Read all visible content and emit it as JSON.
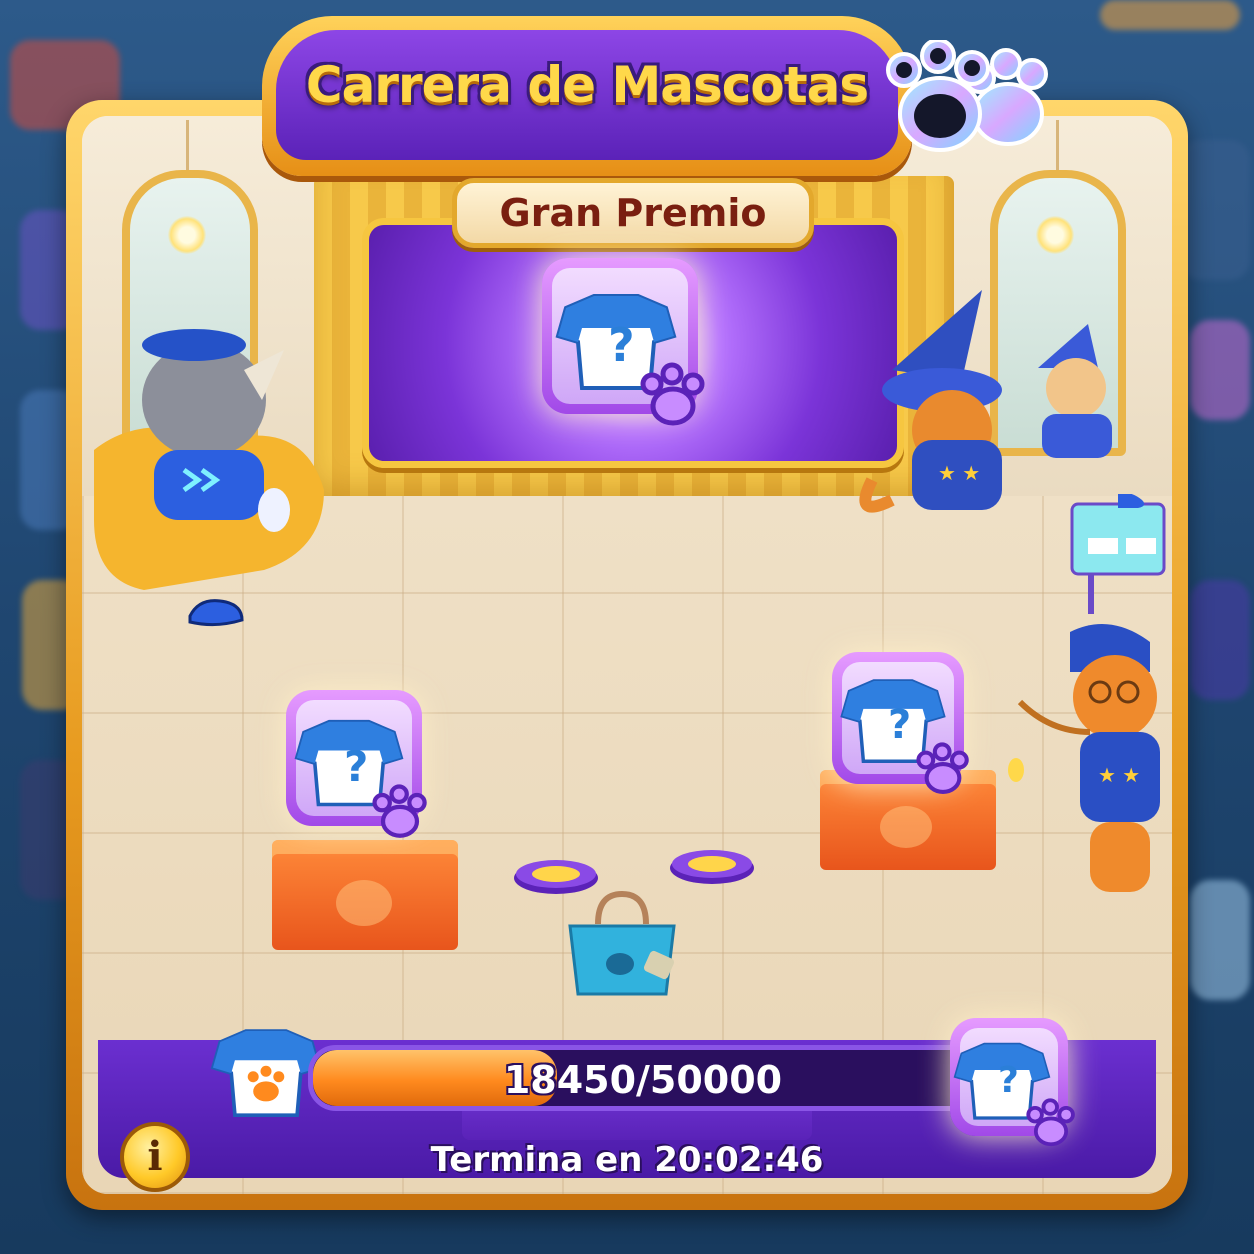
{
  "event": {
    "title": "Carrera de Mascotas",
    "grand_prize_label": "Gran Premio"
  },
  "progress": {
    "current": 18450,
    "goal": 50000,
    "text": "18450/50000",
    "fraction": 0.369
  },
  "timer": {
    "text": "Termina en 20:02:46"
  },
  "info_button": {
    "label": "i"
  },
  "rewards": [
    {
      "name": "grand-prize",
      "symbol": "?"
    },
    {
      "name": "left-reward",
      "symbol": "?"
    },
    {
      "name": "right-reward",
      "symbol": "?"
    },
    {
      "name": "progress-goal-reward",
      "symbol": "?"
    }
  ],
  "colors": {
    "frame_gold": "#e79a1f",
    "panel_purple": "#5b22b8",
    "progress_orange": "#ff8a1e",
    "title_yellow": "#ffd84a"
  },
  "icons": [
    "paw-icon",
    "shirt-icon",
    "question-icon",
    "info-icon",
    "shopping-bag-icon"
  ]
}
